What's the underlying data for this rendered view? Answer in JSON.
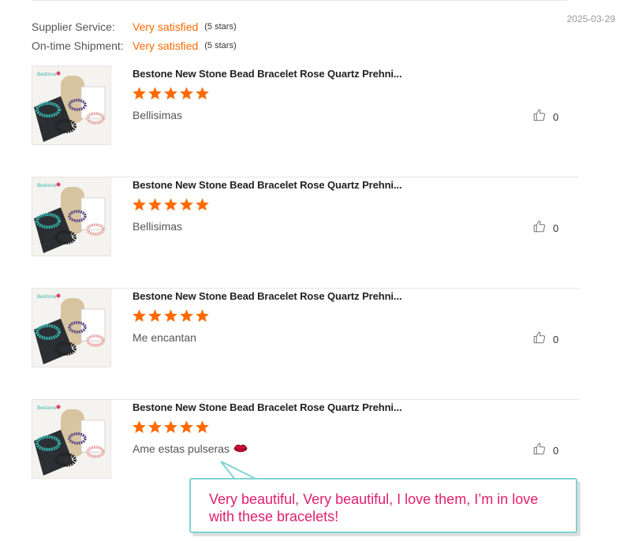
{
  "review_date": "2025-03-29",
  "ratings": [
    {
      "label": "Supplier Service:",
      "value": "Very satisfied",
      "note": "(5 stars)"
    },
    {
      "label": "On-time Shipment:",
      "value": "Very satisfied",
      "note": "(5 stars)"
    }
  ],
  "products": [
    {
      "title": "Bestone New Stone Bead Bracelet Rose Quartz Prehni...",
      "stars": 5,
      "comment": "Bellisimas",
      "likes": "0"
    },
    {
      "title": "Bestone New Stone Bead Bracelet Rose Quartz Prehni...",
      "stars": 5,
      "comment": "Bellisimas",
      "likes": "0"
    },
    {
      "title": "Bestone New Stone Bead Bracelet Rose Quartz Prehni...",
      "stars": 5,
      "comment": "Me encantan",
      "likes": "0"
    },
    {
      "title": "Bestone New Stone Bead Bracelet Rose Quartz Prehni...",
      "stars": 5,
      "comment": "Ame estas pulseras",
      "likes": "0",
      "emoji": "lips-emoji"
    }
  ],
  "translation": "Very beautiful, Very beautiful, I love them, I’m in love with these bracelets!",
  "colors": {
    "accent": "#ff6a00",
    "translation_text": "#e0206e",
    "translation_border": "#7fd3d3"
  },
  "icons": {
    "rating": "star-icon",
    "like": "thumbs-up-icon"
  }
}
